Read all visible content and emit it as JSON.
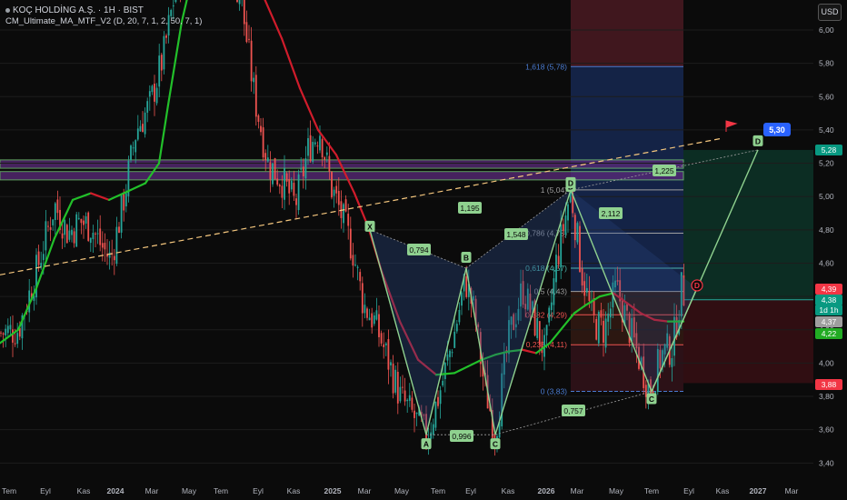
{
  "header": {
    "symbol_line": "KOÇ HOLDİNG A.Ş. · 1H · BIST",
    "indicator_line": "CM_Ultimate_MA_MTF_V2 (D, 20, 7, 1, 2, 50, 7, 1)"
  },
  "currency_button": "USD",
  "colors": {
    "up": "#26a69a",
    "down": "#ef5350",
    "ma_up": "#22c02a",
    "ma_down": "#d01c2b",
    "pattern": "#8fd18f",
    "fib_blue": "#4a7bd0"
  },
  "chart_data": {
    "type": "candlestick",
    "y_axis": {
      "ticks": [
        6.0,
        5.8,
        5.6,
        5.4,
        5.2,
        5.0,
        4.8,
        4.6,
        4.4,
        4.2,
        4.0,
        3.8,
        3.6,
        3.4
      ],
      "tick_labels": [
        "6,00",
        "5,80",
        "5,60",
        "5,40",
        "5,20",
        "5,00",
        "4,80",
        "4,60",
        "4,40",
        "4,20",
        "4,00",
        "3,80",
        "3,60",
        "3,40"
      ],
      "ylim": [
        3.37,
        6.16
      ],
      "scale": "linear"
    },
    "x_axis": {
      "tick_labels": [
        "Tem",
        "Eyl",
        "Kas",
        "2024",
        "Mar",
        "May",
        "Tem",
        "Eyl",
        "Kas",
        "2025",
        "Mar",
        "May",
        "Tem",
        "Eyl",
        "Kas",
        "2026",
        "Mar",
        "May",
        "Tem",
        "Eyl",
        "Kas",
        "2027",
        "Mar"
      ],
      "bold": [
        "2024",
        "2025",
        "2026",
        "2027"
      ]
    },
    "price_labels": [
      {
        "text": "5,30",
        "color": "#2962ff"
      },
      {
        "text": "5,28",
        "color": "#089981"
      },
      {
        "text": "4,39",
        "color": "#f23645"
      },
      {
        "text": "4,38",
        "color": "#089981"
      },
      {
        "text": "1d 1h",
        "color": "#089981"
      },
      {
        "text": "4,37",
        "color": "#9e9e9e"
      },
      {
        "text": "4,22",
        "color": "#22ab23"
      },
      {
        "text": "3,88",
        "color": "#f23645"
      }
    ],
    "price_path": [
      [
        0,
        4.18
      ],
      [
        20,
        4.2
      ],
      [
        40,
        4.55
      ],
      [
        60,
        4.95
      ],
      [
        75,
        4.78
      ],
      [
        88,
        4.85
      ],
      [
        100,
        4.82
      ],
      [
        112,
        4.7
      ],
      [
        122,
        4.62
      ],
      [
        135,
        4.95
      ],
      [
        150,
        5.4
      ],
      [
        165,
        5.55
      ],
      [
        180,
        5.85
      ],
      [
        195,
        6.3
      ],
      [
        215,
        6.6
      ],
      [
        240,
        6.55
      ],
      [
        265,
        6.2
      ],
      [
        280,
        5.6
      ],
      [
        295,
        5.2
      ],
      [
        310,
        5.1
      ],
      [
        325,
        4.95
      ],
      [
        340,
        5.3
      ],
      [
        352,
        5.4
      ],
      [
        365,
        5.05
      ],
      [
        375,
        4.9
      ],
      [
        388,
        4.68
      ],
      [
        400,
        4.35
      ],
      [
        412,
        4.25
      ],
      [
        425,
        4.05
      ],
      [
        440,
        3.8
      ],
      [
        455,
        3.68
      ],
      [
        470,
        3.56
      ],
      [
        485,
        3.85
      ],
      [
        500,
        4.18
      ],
      [
        512,
        4.5
      ],
      [
        522,
        4.3
      ],
      [
        532,
        3.9
      ],
      [
        545,
        3.58
      ],
      [
        560,
        4.15
      ],
      [
        575,
        4.45
      ],
      [
        590,
        4.22
      ],
      [
        600,
        4.05
      ],
      [
        612,
        4.6
      ],
      [
        628,
        5.04
      ],
      [
        640,
        4.55
      ],
      [
        652,
        4.25
      ],
      [
        665,
        4.2
      ],
      [
        678,
        4.45
      ],
      [
        690,
        4.25
      ],
      [
        702,
        4.05
      ],
      [
        715,
        3.83
      ],
      [
        728,
        4.05
      ],
      [
        740,
        4.1
      ],
      [
        750,
        4.45
      ],
      [
        755,
        4.38
      ]
    ],
    "ma_path": [
      [
        0,
        4.12
      ],
      [
        20,
        4.2
      ],
      [
        40,
        4.45
      ],
      [
        60,
        4.75
      ],
      [
        80,
        4.98
      ],
      [
        100,
        5.02
      ],
      [
        120,
        4.98
      ],
      [
        140,
        5.03
      ],
      [
        160,
        5.08
      ],
      [
        175,
        5.2
      ],
      [
        185,
        5.55
      ],
      [
        200,
        6.05
      ],
      [
        215,
        6.4
      ],
      [
        240,
        6.55
      ],
      [
        265,
        6.4
      ],
      [
        290,
        6.2
      ],
      [
        310,
        5.95
      ],
      [
        330,
        5.65
      ],
      [
        350,
        5.4
      ],
      [
        370,
        5.25
      ],
      [
        390,
        5.02
      ],
      [
        405,
        4.82
      ],
      [
        420,
        4.55
      ],
      [
        440,
        4.25
      ],
      [
        460,
        4.02
      ],
      [
        480,
        3.93
      ],
      [
        500,
        3.94
      ],
      [
        515,
        3.98
      ],
      [
        530,
        4.02
      ],
      [
        545,
        4.05
      ],
      [
        560,
        4.07
      ],
      [
        575,
        4.08
      ],
      [
        590,
        4.06
      ],
      [
        605,
        4.12
      ],
      [
        620,
        4.22
      ],
      [
        632,
        4.3
      ],
      [
        645,
        4.35
      ],
      [
        660,
        4.4
      ],
      [
        675,
        4.42
      ],
      [
        690,
        4.36
      ],
      [
        705,
        4.3
      ],
      [
        720,
        4.26
      ],
      [
        735,
        4.25
      ],
      [
        752,
        4.25
      ]
    ],
    "purple_zones": [
      {
        "y_top": 5.22,
        "y_bottom": 5.17
      },
      {
        "y_top": 5.15,
        "y_bottom": 5.1
      }
    ],
    "fib_box": {
      "x_start": 628,
      "x_end": 752,
      "levels": [
        {
          "value": 5.78,
          "label": "1,618 (5,78)",
          "color": "#4a7bd0"
        },
        {
          "value": 5.04,
          "label": "1 (5,04)",
          "color": "#9e9e9e"
        },
        {
          "value": 4.78,
          "label": "0,786 (4,78)",
          "color": "#9e9e9e"
        },
        {
          "value": 4.57,
          "label": "0,618 (4,57)",
          "color": "#4db6ac"
        },
        {
          "value": 4.43,
          "label": "0,5 (4,43)",
          "color": "#9e9e9e"
        },
        {
          "value": 4.29,
          "label": "0,382 (4,29)",
          "color": "#ef5350"
        },
        {
          "value": 4.11,
          "label": "0,236 (4,11)",
          "color": "#ef5350"
        },
        {
          "value": 3.83,
          "label": "0 (3,83)",
          "color": "#4a7bd0"
        }
      ]
    },
    "pattern_1": {
      "points": [
        {
          "x": 407,
          "price": 4.8,
          "label": "X"
        },
        {
          "x": 469,
          "price": 3.57,
          "label": "A"
        },
        {
          "x": 513,
          "price": 4.57,
          "label": "B"
        },
        {
          "x": 545,
          "price": 3.57,
          "label": "C"
        },
        {
          "x": 628,
          "price": 5.04,
          "label": "D"
        }
      ],
      "ratios": [
        {
          "text": "0,794"
        },
        {
          "text": "1,195"
        },
        {
          "text": "0,996"
        },
        {
          "text": "1,548"
        }
      ]
    },
    "pattern_2": {
      "points": [
        {
          "x": 628,
          "price": 5.04,
          "label": "X"
        },
        {
          "x": 717,
          "price": 3.83,
          "label": "C"
        },
        {
          "x": 767,
          "price": 4.45,
          "label": "D"
        },
        {
          "x": 834,
          "price": 5.28,
          "label": "D"
        }
      ],
      "ratios": [
        {
          "text": "0,757"
        },
        {
          "text": "2,112"
        },
        {
          "text": "1,225"
        }
      ]
    },
    "trendline": {
      "from": [
        0,
        4.53
      ],
      "to": [
        795,
        5.35
      ]
    },
    "target_label": "5,30",
    "long_position": {
      "x_start": 752,
      "x_end": 932,
      "entry": 4.38,
      "target": 5.28,
      "stop": 3.88
    }
  }
}
